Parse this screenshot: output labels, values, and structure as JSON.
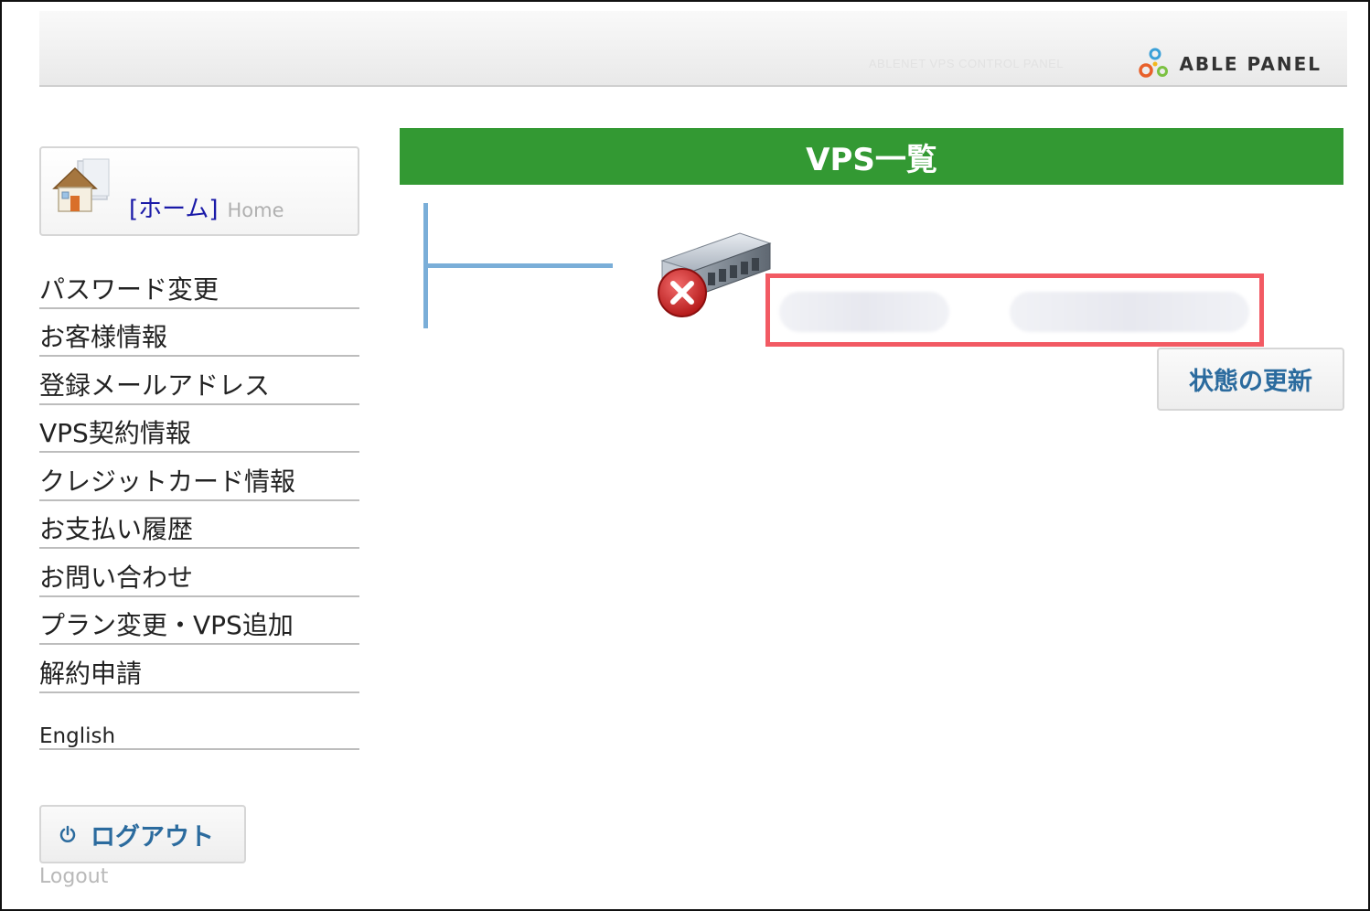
{
  "header": {
    "subtitle": "ABLENET VPS CONTROL PANEL",
    "logo_text": "ABLE PANEL"
  },
  "sidebar": {
    "home": {
      "label": "[ホーム]",
      "sublabel": "Home"
    },
    "menu": [
      {
        "label": "パスワード変更"
      },
      {
        "label": "お客様情報"
      },
      {
        "label": "登録メールアドレス"
      },
      {
        "label": "VPS契約情報"
      },
      {
        "label": "クレジットカード情報"
      },
      {
        "label": "お支払い履歴"
      },
      {
        "label": "お問い合わせ"
      },
      {
        "label": "プラン変更・VPS追加"
      },
      {
        "label": "解約申請"
      }
    ],
    "english": "English",
    "logout": {
      "label": "ログアウト",
      "sublabel": "Logout"
    }
  },
  "main": {
    "title": "VPS一覧",
    "vps_status": "stopped",
    "refresh_label": "状態の更新"
  },
  "colors": {
    "header_green": "#339933",
    "highlight_red": "#f25a63",
    "link_blue": "#1a1aa8",
    "button_text": "#2b6b9e",
    "tree_line": "#7aaed8"
  }
}
